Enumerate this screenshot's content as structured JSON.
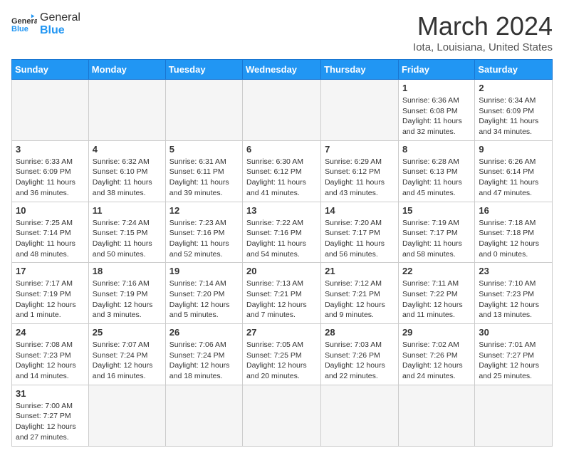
{
  "header": {
    "logo_general": "General",
    "logo_blue": "Blue",
    "month": "March 2024",
    "location": "Iota, Louisiana, United States"
  },
  "weekdays": [
    "Sunday",
    "Monday",
    "Tuesday",
    "Wednesday",
    "Thursday",
    "Friday",
    "Saturday"
  ],
  "weeks": [
    [
      {
        "day": "",
        "info": ""
      },
      {
        "day": "",
        "info": ""
      },
      {
        "day": "",
        "info": ""
      },
      {
        "day": "",
        "info": ""
      },
      {
        "day": "",
        "info": ""
      },
      {
        "day": "1",
        "info": "Sunrise: 6:36 AM\nSunset: 6:08 PM\nDaylight: 11 hours\nand 32 minutes."
      },
      {
        "day": "2",
        "info": "Sunrise: 6:34 AM\nSunset: 6:09 PM\nDaylight: 11 hours\nand 34 minutes."
      }
    ],
    [
      {
        "day": "3",
        "info": "Sunrise: 6:33 AM\nSunset: 6:09 PM\nDaylight: 11 hours\nand 36 minutes."
      },
      {
        "day": "4",
        "info": "Sunrise: 6:32 AM\nSunset: 6:10 PM\nDaylight: 11 hours\nand 38 minutes."
      },
      {
        "day": "5",
        "info": "Sunrise: 6:31 AM\nSunset: 6:11 PM\nDaylight: 11 hours\nand 39 minutes."
      },
      {
        "day": "6",
        "info": "Sunrise: 6:30 AM\nSunset: 6:12 PM\nDaylight: 11 hours\nand 41 minutes."
      },
      {
        "day": "7",
        "info": "Sunrise: 6:29 AM\nSunset: 6:12 PM\nDaylight: 11 hours\nand 43 minutes."
      },
      {
        "day": "8",
        "info": "Sunrise: 6:28 AM\nSunset: 6:13 PM\nDaylight: 11 hours\nand 45 minutes."
      },
      {
        "day": "9",
        "info": "Sunrise: 6:26 AM\nSunset: 6:14 PM\nDaylight: 11 hours\nand 47 minutes."
      }
    ],
    [
      {
        "day": "10",
        "info": "Sunrise: 7:25 AM\nSunset: 7:14 PM\nDaylight: 11 hours\nand 48 minutes."
      },
      {
        "day": "11",
        "info": "Sunrise: 7:24 AM\nSunset: 7:15 PM\nDaylight: 11 hours\nand 50 minutes."
      },
      {
        "day": "12",
        "info": "Sunrise: 7:23 AM\nSunset: 7:16 PM\nDaylight: 11 hours\nand 52 minutes."
      },
      {
        "day": "13",
        "info": "Sunrise: 7:22 AM\nSunset: 7:16 PM\nDaylight: 11 hours\nand 54 minutes."
      },
      {
        "day": "14",
        "info": "Sunrise: 7:20 AM\nSunset: 7:17 PM\nDaylight: 11 hours\nand 56 minutes."
      },
      {
        "day": "15",
        "info": "Sunrise: 7:19 AM\nSunset: 7:17 PM\nDaylight: 11 hours\nand 58 minutes."
      },
      {
        "day": "16",
        "info": "Sunrise: 7:18 AM\nSunset: 7:18 PM\nDaylight: 12 hours\nand 0 minutes."
      }
    ],
    [
      {
        "day": "17",
        "info": "Sunrise: 7:17 AM\nSunset: 7:19 PM\nDaylight: 12 hours\nand 1 minute."
      },
      {
        "day": "18",
        "info": "Sunrise: 7:16 AM\nSunset: 7:19 PM\nDaylight: 12 hours\nand 3 minutes."
      },
      {
        "day": "19",
        "info": "Sunrise: 7:14 AM\nSunset: 7:20 PM\nDaylight: 12 hours\nand 5 minutes."
      },
      {
        "day": "20",
        "info": "Sunrise: 7:13 AM\nSunset: 7:21 PM\nDaylight: 12 hours\nand 7 minutes."
      },
      {
        "day": "21",
        "info": "Sunrise: 7:12 AM\nSunset: 7:21 PM\nDaylight: 12 hours\nand 9 minutes."
      },
      {
        "day": "22",
        "info": "Sunrise: 7:11 AM\nSunset: 7:22 PM\nDaylight: 12 hours\nand 11 minutes."
      },
      {
        "day": "23",
        "info": "Sunrise: 7:10 AM\nSunset: 7:23 PM\nDaylight: 12 hours\nand 13 minutes."
      }
    ],
    [
      {
        "day": "24",
        "info": "Sunrise: 7:08 AM\nSunset: 7:23 PM\nDaylight: 12 hours\nand 14 minutes."
      },
      {
        "day": "25",
        "info": "Sunrise: 7:07 AM\nSunset: 7:24 PM\nDaylight: 12 hours\nand 16 minutes."
      },
      {
        "day": "26",
        "info": "Sunrise: 7:06 AM\nSunset: 7:24 PM\nDaylight: 12 hours\nand 18 minutes."
      },
      {
        "day": "27",
        "info": "Sunrise: 7:05 AM\nSunset: 7:25 PM\nDaylight: 12 hours\nand 20 minutes."
      },
      {
        "day": "28",
        "info": "Sunrise: 7:03 AM\nSunset: 7:26 PM\nDaylight: 12 hours\nand 22 minutes."
      },
      {
        "day": "29",
        "info": "Sunrise: 7:02 AM\nSunset: 7:26 PM\nDaylight: 12 hours\nand 24 minutes."
      },
      {
        "day": "30",
        "info": "Sunrise: 7:01 AM\nSunset: 7:27 PM\nDaylight: 12 hours\nand 25 minutes."
      }
    ],
    [
      {
        "day": "31",
        "info": "Sunrise: 7:00 AM\nSunset: 7:27 PM\nDaylight: 12 hours\nand 27 minutes."
      },
      {
        "day": "",
        "info": ""
      },
      {
        "day": "",
        "info": ""
      },
      {
        "day": "",
        "info": ""
      },
      {
        "day": "",
        "info": ""
      },
      {
        "day": "",
        "info": ""
      },
      {
        "day": "",
        "info": ""
      }
    ]
  ]
}
